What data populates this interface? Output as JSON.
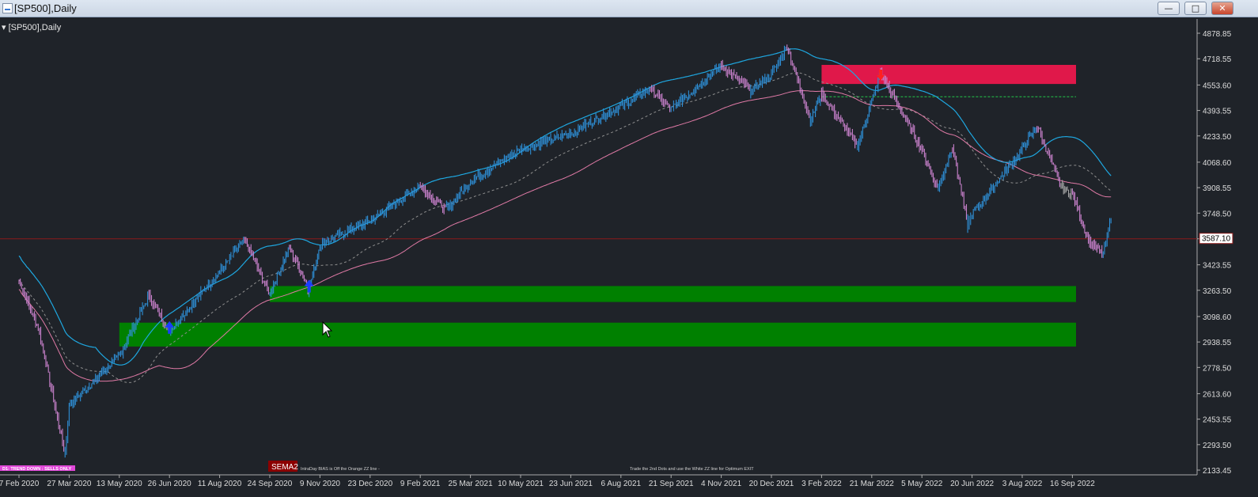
{
  "window": {
    "title": "[SP500],Daily",
    "buttons": {
      "minimize": "—",
      "maximize": "□",
      "close": "✕"
    }
  },
  "chart_label": "[SP500],Daily",
  "current_price": "3587.10",
  "sema_label": "SEMA2",
  "bottom_texts": {
    "left_badge": "D1: TREND DOWN : SELLS ONLY",
    "intraday_note": "IntraDay BIAS is Off the Orange ZZ line -",
    "exit_note": "Trade the 2nd Dots and use the White ZZ line for Optimum EXIT"
  },
  "colors": {
    "background": "#1f2329",
    "bullish_bars": "#2e8fd6",
    "bearish_bars": "#c981cc",
    "neutral_bars": "#a9a9a9",
    "demand_zone": "#008000",
    "supply_zone": "#e0184a",
    "upper_band": "#1ea7e0",
    "middle_ma": "#8f8f8f",
    "slow_ma": "#e07aa6",
    "price_line": "#8b1a1a"
  },
  "chart_data": {
    "type": "candlestick",
    "title": "[SP500],Daily",
    "y_ticks": [
      "4878.85",
      "4718.55",
      "4553.60",
      "4393.55",
      "4233.50",
      "4068.60",
      "3908.55",
      "3748.50",
      "3587.10",
      "3423.55",
      "3263.50",
      "3098.60",
      "2938.55",
      "2778.50",
      "2613.60",
      "2453.55",
      "2293.50",
      "2133.45"
    ],
    "x_ticks": [
      "7 Feb 2020",
      "27 Mar 2020",
      "13 May 2020",
      "26 Jun 2020",
      "11 Aug 2020",
      "24 Sep 2020",
      "9 Nov 2020",
      "23 Dec 2020",
      "9 Feb 2021",
      "25 Mar 2021",
      "10 May 2021",
      "23 Jun 2021",
      "6 Aug 2021",
      "21 Sep 2021",
      "4 Nov 2021",
      "20 Dec 2021",
      "3 Feb 2022",
      "21 Mar 2022",
      "5 May 2022",
      "20 Jun 2022",
      "3 Aug 2022",
      "16 Sep 2022"
    ],
    "ylim": [
      2133.45,
      4878.85
    ],
    "price_path": [
      {
        "date": "7 Feb 2020",
        "close": 3330
      },
      {
        "date": "27 Feb 2020",
        "close": 3000
      },
      {
        "date": "23 Mar 2020",
        "close": 2230
      },
      {
        "date": "27 Mar 2020",
        "close": 2540
      },
      {
        "date": "13 May 2020",
        "close": 2850
      },
      {
        "date": "8 Jun 2020",
        "close": 3230
      },
      {
        "date": "26 Jun 2020",
        "close": 3010
      },
      {
        "date": "11 Aug 2020",
        "close": 3380
      },
      {
        "date": "2 Sep 2020",
        "close": 3580
      },
      {
        "date": "24 Sep 2020",
        "close": 3240
      },
      {
        "date": "12 Oct 2020",
        "close": 3530
      },
      {
        "date": "30 Oct 2020",
        "close": 3270
      },
      {
        "date": "9 Nov 2020",
        "close": 3550
      },
      {
        "date": "23 Dec 2020",
        "close": 3700
      },
      {
        "date": "9 Feb 2021",
        "close": 3920
      },
      {
        "date": "4 Mar 2021",
        "close": 3770
      },
      {
        "date": "25 Mar 2021",
        "close": 3950
      },
      {
        "date": "10 May 2021",
        "close": 4150
      },
      {
        "date": "23 Jun 2021",
        "close": 4250
      },
      {
        "date": "6 Aug 2021",
        "close": 4420
      },
      {
        "date": "2 Sep 2021",
        "close": 4530
      },
      {
        "date": "21 Sep 2021",
        "close": 4400
      },
      {
        "date": "4 Nov 2021",
        "close": 4680
      },
      {
        "date": "1 Dec 2021",
        "close": 4520
      },
      {
        "date": "20 Dec 2021",
        "close": 4620
      },
      {
        "date": "3 Jan 2022",
        "close": 4800
      },
      {
        "date": "24 Jan 2022",
        "close": 4330
      },
      {
        "date": "3 Feb 2022",
        "close": 4500
      },
      {
        "date": "8 Mar 2022",
        "close": 4170
      },
      {
        "date": "29 Mar 2022",
        "close": 4630
      },
      {
        "date": "5 May 2022",
        "close": 4150
      },
      {
        "date": "20 May 2022",
        "close": 3900
      },
      {
        "date": "2 Jun 2022",
        "close": 4170
      },
      {
        "date": "16 Jun 2022",
        "close": 3670
      },
      {
        "date": "20 Jun 2022",
        "close": 3740
      },
      {
        "date": "3 Aug 2022",
        "close": 4150
      },
      {
        "date": "16 Aug 2022",
        "close": 4300
      },
      {
        "date": "6 Sep 2022",
        "close": 3910
      },
      {
        "date": "16 Sep 2022",
        "close": 3870
      },
      {
        "date": "30 Sep 2022",
        "close": 3580
      },
      {
        "date": "13 Oct 2022",
        "close": 3490
      },
      {
        "date": "21 Oct 2022",
        "close": 3750
      }
    ],
    "zones": [
      {
        "kind": "supply",
        "from": "3 Feb 2022",
        "to": "end",
        "high": 4680,
        "low": 4560
      },
      {
        "kind": "demand",
        "from": "24 Sep 2020",
        "to": "end",
        "high": 3290,
        "low": 3190
      },
      {
        "kind": "demand",
        "from": "13 May 2020",
        "to": "end",
        "high": 3060,
        "low": 2910
      }
    ],
    "signal_arrows": [
      {
        "date": "26 Jun 2020",
        "direction": "up",
        "price": 3010
      },
      {
        "date": "30 Oct 2020",
        "direction": "up",
        "price": 3270
      },
      {
        "date": "29 Mar 2022",
        "direction": "down",
        "price": 4630
      }
    ],
    "horizontal_lines": [
      {
        "price": 3587.1,
        "style": "solid",
        "color": "#8b1a1a"
      },
      {
        "price": 4480,
        "style": "dashed",
        "color": "#22c84a",
        "from": "3 Feb 2022"
      }
    ]
  }
}
